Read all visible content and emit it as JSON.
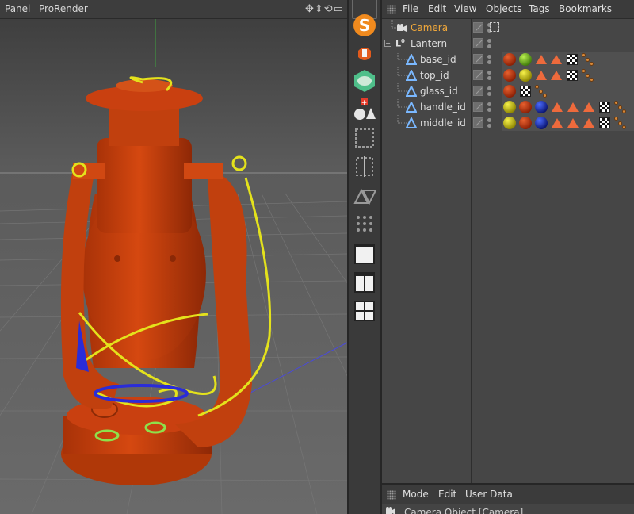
{
  "viewport": {
    "menu": [
      "Panel",
      "ProRender"
    ],
    "nav_icons": [
      "move-icon",
      "zoom-icon",
      "rotate-icon",
      "maximize-icon"
    ]
  },
  "palette": {
    "tools": [
      "snap-icon",
      "workplane-icon",
      "axis-lock-icon",
      "primitive-icon",
      "array-icon",
      "symmetry-icon",
      "mirror-icon",
      "grid-icon",
      "layout-single-icon",
      "layout-two-icon",
      "layout-four-icon"
    ]
  },
  "object_manager": {
    "menu": [
      "File",
      "Edit",
      "View",
      "Objects",
      "Tags",
      "Bookmarks"
    ],
    "objects": [
      {
        "name": "Camera",
        "icon": "camera-icon",
        "highlight": true,
        "tags": [
          "target-tag"
        ]
      },
      {
        "name": "Lantern",
        "icon": "null-icon",
        "highlight": false,
        "tags": []
      },
      {
        "name": "base_id",
        "icon": "polygon-icon",
        "highlight": false,
        "tags": [
          "material-red",
          "material-green",
          "selection-tag",
          "selection-tag",
          "texture-tag",
          "phong-tag"
        ]
      },
      {
        "name": "top_id",
        "icon": "polygon-icon",
        "highlight": false,
        "tags": [
          "material-red",
          "material-yellow",
          "selection-tag",
          "selection-tag",
          "texture-tag",
          "phong-tag"
        ]
      },
      {
        "name": "glass_id",
        "icon": "polygon-icon",
        "highlight": false,
        "tags": [
          "material-red",
          "texture-tag",
          "phong-tag"
        ]
      },
      {
        "name": "handle_id",
        "icon": "polygon-icon",
        "highlight": false,
        "tags": [
          "material-yellow",
          "material-red",
          "material-blue",
          "selection-tag",
          "selection-tag",
          "selection-tag",
          "texture-tag",
          "phong-tag"
        ]
      },
      {
        "name": "middle_id",
        "icon": "polygon-icon",
        "highlight": false,
        "tags": [
          "material-yellow",
          "material-red",
          "material-blue",
          "selection-tag",
          "selection-tag",
          "selection-tag",
          "texture-tag",
          "phong-tag"
        ]
      }
    ]
  },
  "attribute_manager": {
    "menu": [
      "Mode",
      "Edit",
      "User Data"
    ],
    "title": "Camera Object [Camera]"
  },
  "colors": {
    "highlight_text": "#f2a93b",
    "lantern_body": "#c94010",
    "wire_yellow": "#e4e21c",
    "wire_blue": "#2a2cd8"
  }
}
